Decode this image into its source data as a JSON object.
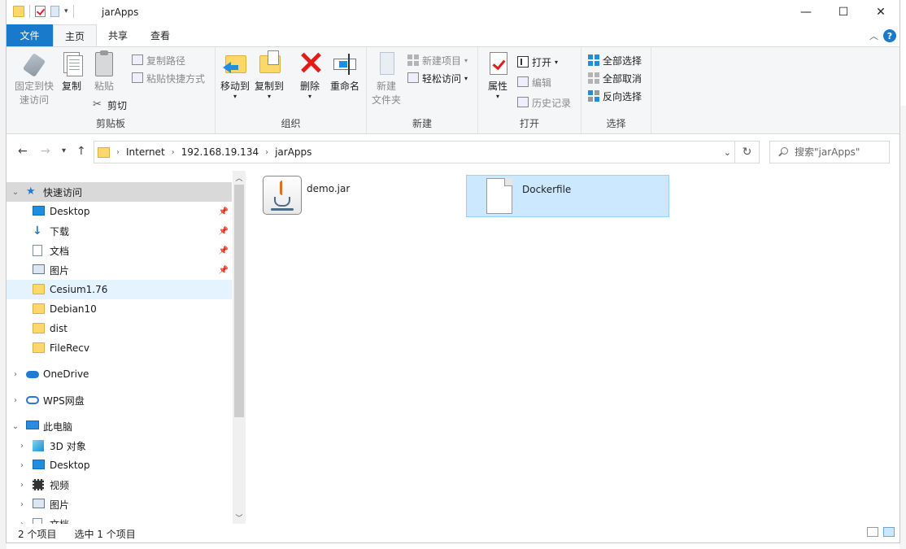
{
  "window": {
    "title": "jarApps",
    "minimize": "—",
    "maximize": "☐",
    "close": "✕"
  },
  "ribbon": {
    "tabs": [
      {
        "label": "文件"
      },
      {
        "label": "主页"
      },
      {
        "label": "共享"
      },
      {
        "label": "查看"
      }
    ],
    "help": "?",
    "clipboard": {
      "label": "剪贴板",
      "pin": "固定到快\n速访问",
      "copy": "复制",
      "paste": "粘贴",
      "copy_path": "复制路径",
      "paste_shortcut": "粘贴快捷方式",
      "cut": "剪切"
    },
    "organize": {
      "label": "组织",
      "move_to": "移动到",
      "copy_to": "复制到",
      "delete": "删除",
      "rename": "重命名"
    },
    "new": {
      "label": "新建",
      "new_folder": "新建\n文件夹",
      "new_item": "新建项目",
      "easy_access": "轻松访问"
    },
    "open": {
      "label": "打开",
      "properties": "属性",
      "open": "打开",
      "edit": "编辑",
      "history": "历史记录"
    },
    "select": {
      "label": "选择",
      "select_all": "全部选择",
      "select_none": "全部取消",
      "invert": "反向选择"
    }
  },
  "address": {
    "crumbs": [
      "Internet",
      "192.168.19.134",
      "jarApps"
    ],
    "search_placeholder": "搜索\"jarApps\""
  },
  "nav": {
    "quick_access": "快速访问",
    "quick_items": [
      {
        "label": "Desktop",
        "icon": "desktop-icon",
        "pinned": true
      },
      {
        "label": "下载",
        "icon": "download-icon",
        "pinned": true
      },
      {
        "label": "文档",
        "icon": "documents-icon",
        "pinned": true
      },
      {
        "label": "图片",
        "icon": "pictures-icon",
        "pinned": true
      },
      {
        "label": "Cesium1.76",
        "icon": "folder-icon"
      },
      {
        "label": "Debian10",
        "icon": "folder-icon"
      },
      {
        "label": "dist",
        "icon": "folder-icon"
      },
      {
        "label": "FileRecv",
        "icon": "folder-icon"
      }
    ],
    "onedrive": "OneDrive",
    "wps": "WPS网盘",
    "this_pc": "此电脑",
    "pc_items": [
      {
        "label": "3D 对象",
        "icon": "3d-objects-icon"
      },
      {
        "label": "Desktop",
        "icon": "desktop-icon"
      },
      {
        "label": "视频",
        "icon": "videos-icon"
      },
      {
        "label": "图片",
        "icon": "pictures-icon"
      },
      {
        "label": "文档",
        "icon": "documents-icon"
      }
    ]
  },
  "files": [
    {
      "name": "demo.jar",
      "icon": "java-jar-icon",
      "selected": false
    },
    {
      "name": "Dockerfile",
      "icon": "file-icon",
      "selected": true
    }
  ],
  "status": {
    "count": "2 个项目",
    "selected": "选中 1 个项目"
  },
  "colors": {
    "accent": "#1979ca",
    "selection": "#cce8ff",
    "folder": "#fcd86a"
  }
}
